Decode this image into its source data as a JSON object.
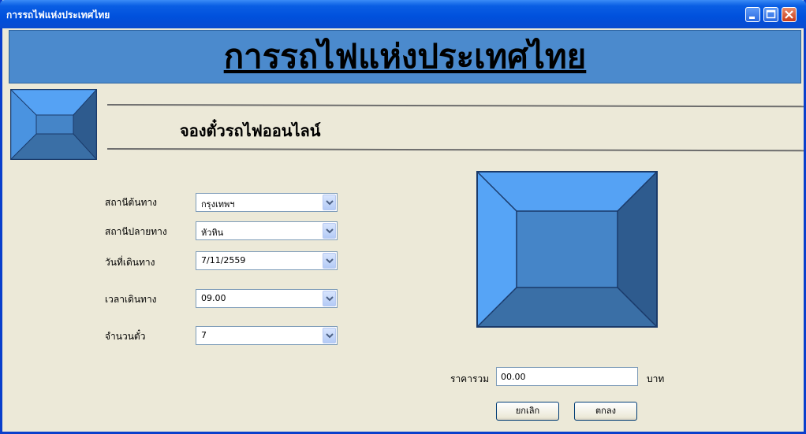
{
  "window": {
    "title": "การรถไฟแห่งประเทศไทย"
  },
  "header": {
    "banner_title": "การรถไฟแห่งประเทศไทย",
    "subtitle": "จองตั๋วรถไฟออนไลน์"
  },
  "form": {
    "origin": {
      "label": "สถานีต้นทาง",
      "value": "กรุงเทพฯ"
    },
    "destination": {
      "label": "สถานีปลายทาง",
      "value": "หัวหิน"
    },
    "date": {
      "label": "วันที่เดินทาง",
      "value": "7/11/2559"
    },
    "time": {
      "label": "เวลาเดินทาง",
      "value": "09.00"
    },
    "tickets": {
      "label": "จำนวนตั๋ว",
      "value": "7"
    }
  },
  "total": {
    "label": "ราคารวม",
    "value": "00.00",
    "unit": "บาท"
  },
  "buttons": {
    "cancel": "ยกเลิก",
    "ok": "ตกลง"
  },
  "colors": {
    "banner": "#4b8acd",
    "picture_light": "#55a2f4",
    "picture_mid": "#4585c8",
    "picture_dark": "#2e5b8e",
    "picture_bottom": "#3a6fa6"
  }
}
